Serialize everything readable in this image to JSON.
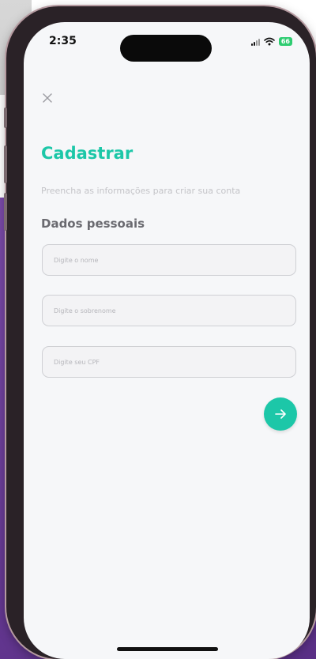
{
  "status_bar": {
    "time": "2:35",
    "battery": "66"
  },
  "header": {
    "title": "Cadastrar",
    "subtitle": "Preencha as informações para criar sua conta"
  },
  "section": {
    "label": "Dados pessoais"
  },
  "form": {
    "name_placeholder": "Digite o nome",
    "surname_placeholder": "Digite o sobrenome",
    "cpf_placeholder": "Digite seu CPF"
  },
  "icons": {
    "close": "close-icon",
    "next": "arrow-right-icon"
  },
  "colors": {
    "accent": "#1cc7a8",
    "screen_background": "#f6f7f9",
    "backdrop_purple": "#6b3d98"
  }
}
